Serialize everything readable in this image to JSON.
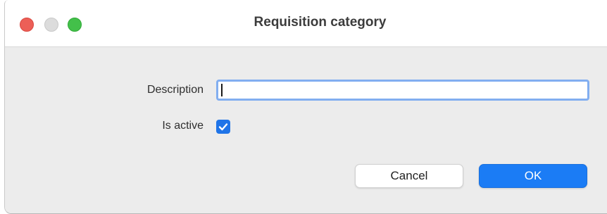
{
  "window": {
    "title": "Requisition category"
  },
  "form": {
    "description_label": "Description",
    "description_value": "",
    "is_active_label": "Is active",
    "is_active_checked": true
  },
  "buttons": {
    "cancel_label": "Cancel",
    "ok_label": "OK"
  },
  "colors": {
    "accent": "#1b7cf5",
    "focus_ring": "#82aef0",
    "close": "#ec5f57",
    "maximize": "#43c04a"
  }
}
